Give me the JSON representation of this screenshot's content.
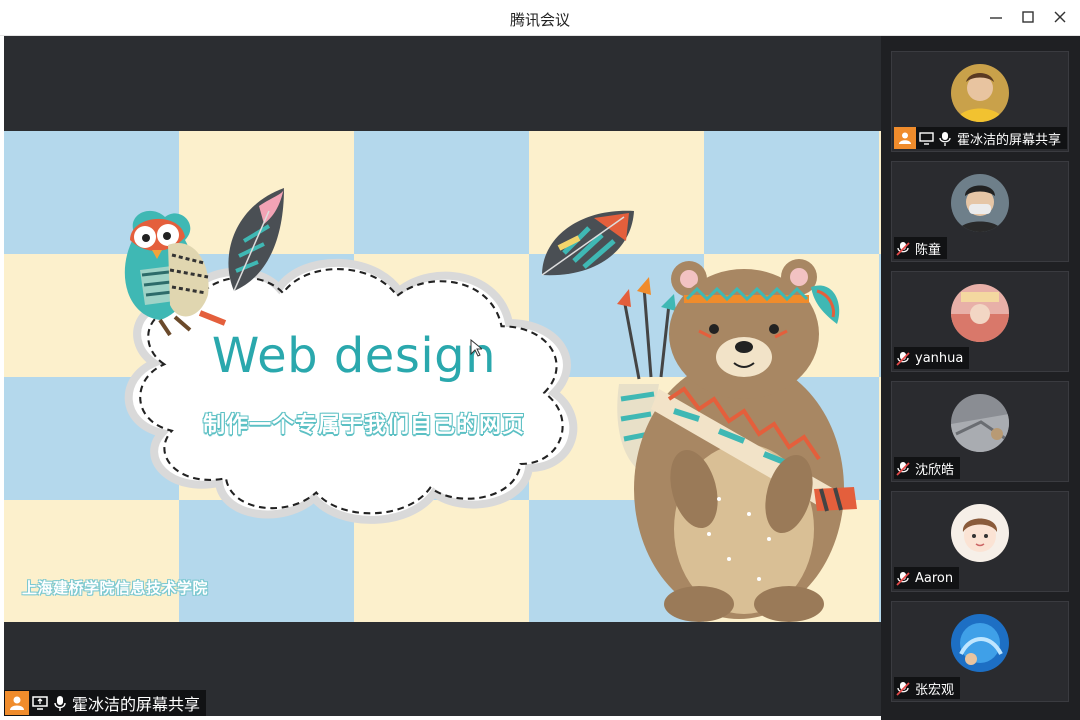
{
  "window": {
    "title": "腾讯会议",
    "icons": [
      "minimize-icon",
      "maximize-icon",
      "close-icon"
    ]
  },
  "slide": {
    "title": "Web design",
    "subtitle": "制作一个专属于我们自己的网页",
    "footer": "上海建桥学院信息技术学院",
    "colors": {
      "blue": "#b4d8ec",
      "cream": "#fcf0cc",
      "title": "#2aa8ad"
    }
  },
  "share_label": {
    "text": "霍冰洁的屏幕共享",
    "icons": [
      "person-icon",
      "screen-share-icon",
      "microphone-icon"
    ]
  },
  "participants": [
    {
      "name": "霍冰洁的屏幕共享",
      "sharing": true,
      "muted": false
    },
    {
      "name": "陈童",
      "sharing": false,
      "muted": true
    },
    {
      "name": "yanhua",
      "sharing": false,
      "muted": true
    },
    {
      "name": "沈欣皓",
      "sharing": false,
      "muted": true
    },
    {
      "name": "Aaron",
      "sharing": false,
      "muted": true
    },
    {
      "name": "张宏观",
      "sharing": false,
      "muted": true
    }
  ],
  "accent_color": "#f08c2c"
}
